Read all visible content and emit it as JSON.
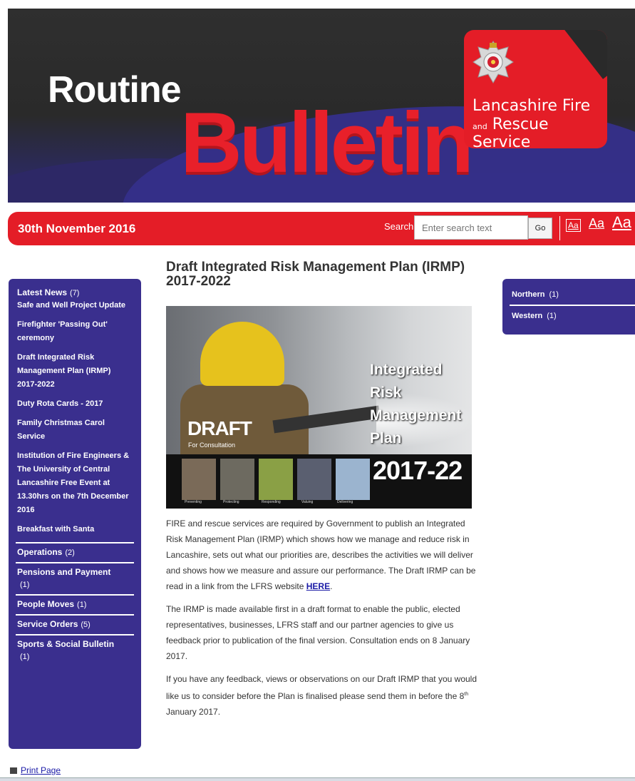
{
  "banner": {
    "title_line1": "Routine",
    "title_line2": "Bulletin",
    "org_line1": "Lancashire Fire",
    "org_line2_prefix": "and",
    "org_line2": "Rescue Service"
  },
  "bar": {
    "date": "30th November 2016",
    "search_label": "Search",
    "search_placeholder": "Enter search text",
    "go_label": "Go",
    "font_small": "Aa",
    "font_medium": "Aa",
    "font_large": "Aa"
  },
  "left_nav": {
    "latest": {
      "label": "Latest News",
      "count": "(7)"
    },
    "news_items": [
      "Safe and Well Project Update",
      "Firefighter 'Passing Out' ceremony",
      "Draft Integrated Risk Management Plan (IRMP) 2017-2022",
      "Duty Rota Cards - 2017",
      "Family Christmas Carol Service",
      "Institution of Fire Engineers & The University of Central Lancashire Free Event at 13.30hrs on the 7th December 2016",
      "Breakfast with Santa"
    ],
    "categories": [
      {
        "label": "Operations",
        "count": "(2)"
      },
      {
        "label": "Pensions and Payment",
        "count": "(1)"
      },
      {
        "label": "People Moves",
        "count": "(1)"
      },
      {
        "label": "Service Orders",
        "count": "(5)"
      },
      {
        "label": "Sports & Social Bulletin",
        "count": "(1)"
      }
    ]
  },
  "article": {
    "title": "Draft Integrated Risk Management Plan (IRMP) 2017-2022",
    "image": {
      "draft": "DRAFT",
      "for_consultation": "For Consultation",
      "irmp_lines": [
        "Integrated",
        "Risk",
        "Management",
        "Plan"
      ],
      "years": "2017-22",
      "thumb_labels": [
        "Preventing",
        "Protecting",
        "Responding",
        "Valuing",
        "Delivering"
      ]
    },
    "p1": "FIRE and rescue services are required by Government to publish an Integrated Risk Management Plan (IRMP) which shows how we manage and reduce risk in Lancashire, sets out what our priorities are, describes the activities we will deliver and shows how we measure and assure our performance. The Draft IRMP can be read in a link from the LFRS website",
    "p1_link": "HERE",
    "p1_end": ".",
    "p2": "The IRMP is made available first in a draft format to enable the public, elected representatives, businesses, LFRS staff and our partner agencies to give us feedback prior to publication of the final version. Consultation ends on 8 January 2017.",
    "p3_start": "If you have any feedback, views or observations on our Draft IRMP that you would like us to consider before the Plan is finalised please send them in before the 8",
    "p3_sup": "th",
    "p3_end": " January 2017."
  },
  "right_nav": {
    "items": [
      {
        "label": "Northern",
        "count": "(1)"
      },
      {
        "label": "Western",
        "count": "(1)"
      }
    ]
  },
  "footer": {
    "print_label": "Print Page"
  },
  "colors": {
    "brand_red": "#e41d27",
    "nav_purple": "#3a2f8e",
    "link_blue": "#1a1aa6"
  }
}
